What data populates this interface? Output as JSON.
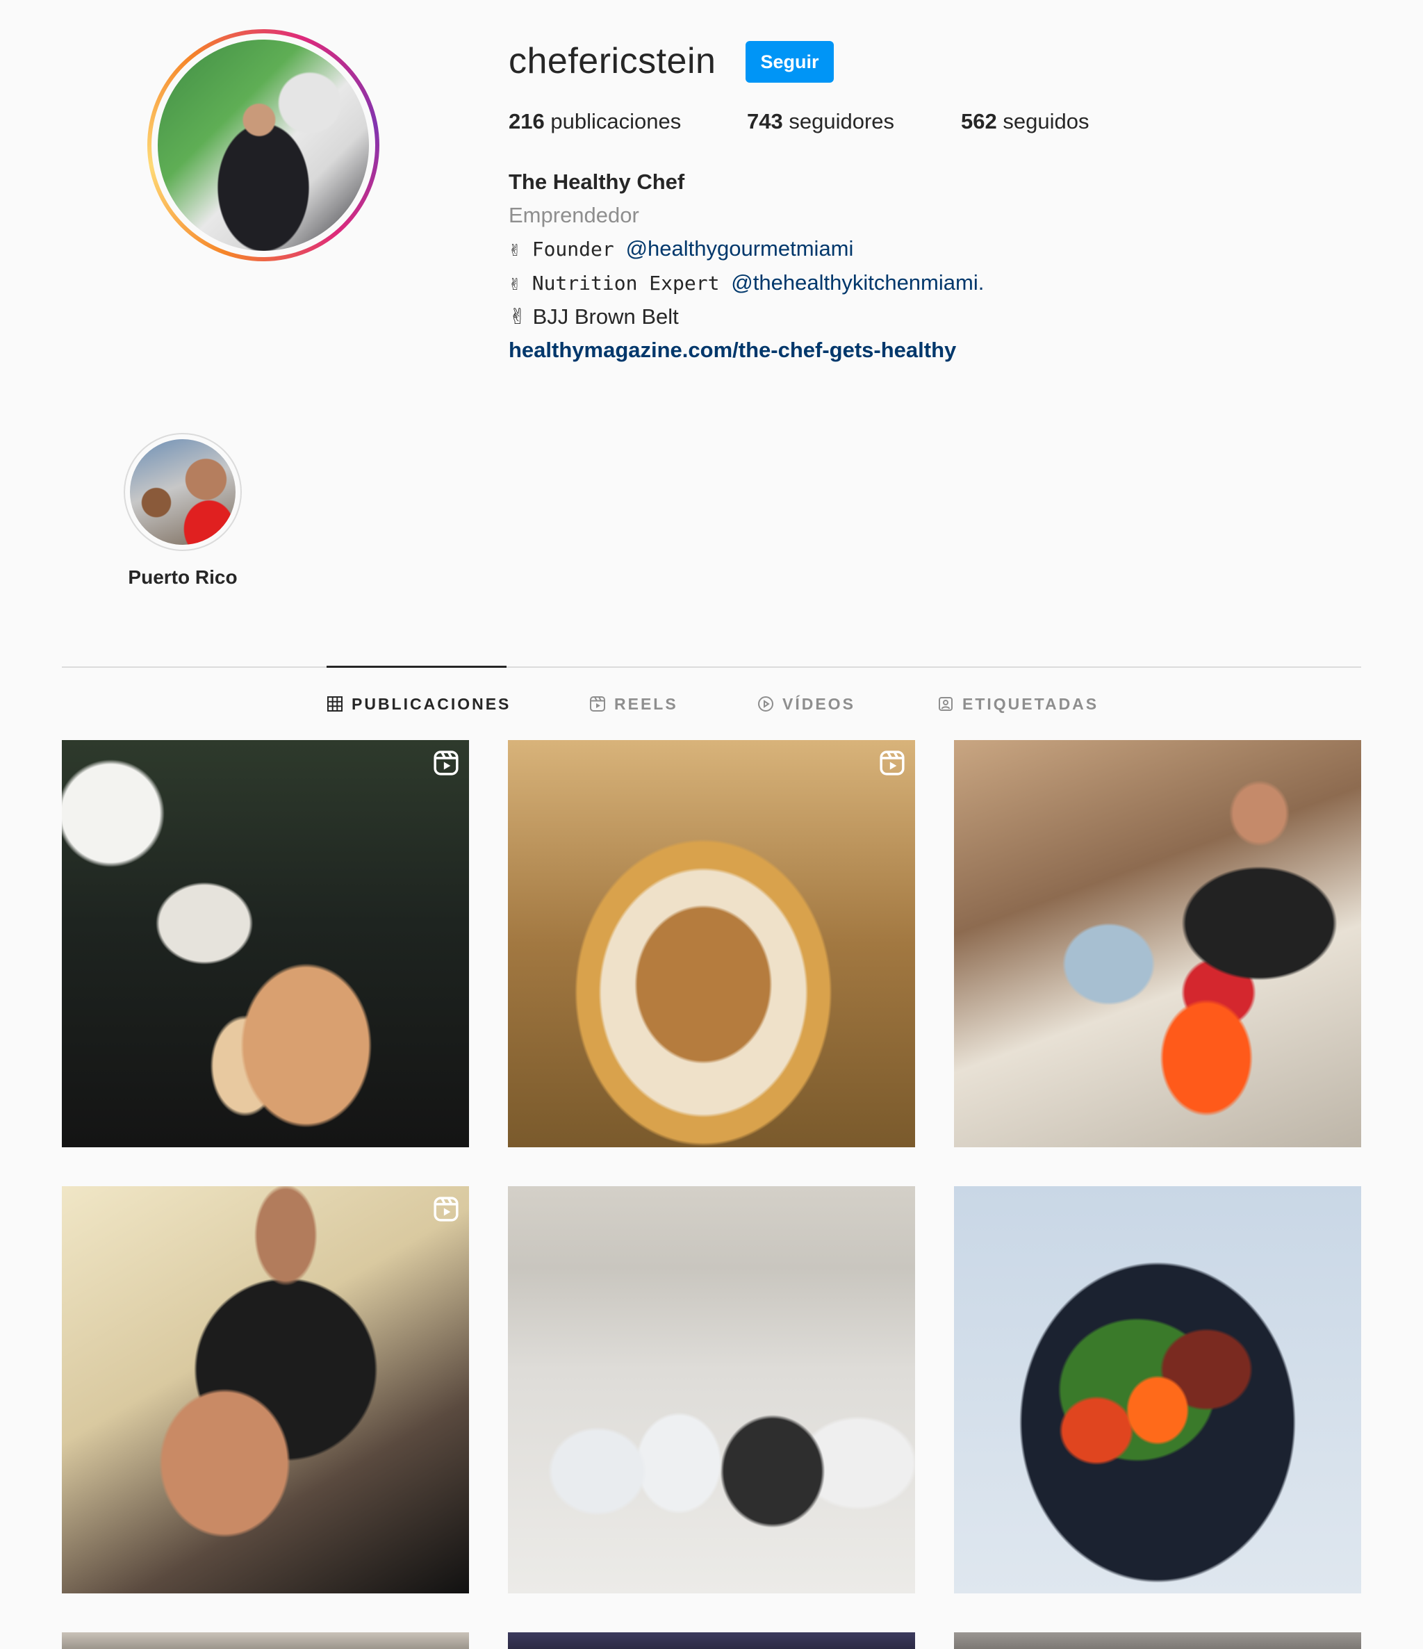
{
  "profile": {
    "username": "chefericstein",
    "follow_label": "Seguir",
    "stats": {
      "posts_count": "216",
      "posts_label": "publicaciones",
      "followers_count": "743",
      "followers_label": "seguidores",
      "following_count": "562",
      "following_label": "seguidos"
    },
    "bio": {
      "name": "The Healthy Chef",
      "category": "Emprendedor",
      "line1_prefix": "✌ Founder ",
      "line1_mention": "@healthygourmetmiami",
      "line2_prefix": "✌ Nutrition Expert ",
      "line2_mention": "@thehealthykitchenmiami",
      "line2_suffix": ".",
      "line3": "✌ BJJ Brown Belt",
      "link": "healthymagazine.com/the-chef-gets-healthy"
    }
  },
  "highlights": [
    {
      "label": "Puerto Rico"
    }
  ],
  "tabs": [
    {
      "label": "PUBLICACIONES",
      "active": true,
      "icon": "grid-icon"
    },
    {
      "label": "REELS",
      "active": false,
      "icon": "reels-icon"
    },
    {
      "label": "VÍDEOS",
      "active": false,
      "icon": "play-icon"
    },
    {
      "label": "ETIQUETADAS",
      "active": false,
      "icon": "tagged-icon"
    }
  ],
  "posts": [
    {
      "is_reel": true
    },
    {
      "is_reel": true
    },
    {
      "is_reel": false
    },
    {
      "is_reel": true
    },
    {
      "is_reel": false
    },
    {
      "is_reel": false
    },
    {
      "is_reel": true
    },
    {
      "is_reel": false
    },
    {
      "is_reel": false
    }
  ],
  "colors": {
    "follow_button": "#0095f6",
    "link": "#00376b",
    "muted": "#8e8e8e",
    "text": "#262626",
    "background": "#fafafa"
  }
}
